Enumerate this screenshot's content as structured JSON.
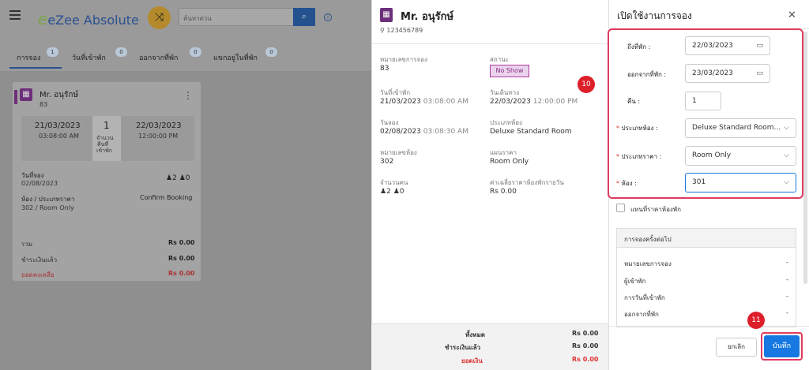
{
  "app": {
    "logo": "eZee Absolute",
    "search_placeholder": "ค้นหาด่วน"
  },
  "tabs": [
    {
      "label": "การจอง",
      "count": "1"
    },
    {
      "label": "วันที่เข้าพัก",
      "count": "0"
    },
    {
      "label": "ออกจากที่พัก",
      "count": "0"
    },
    {
      "label": "แขกอยู่ในที่พัก",
      "count": "0"
    }
  ],
  "card": {
    "guest": "Mr. อนุรักษ์",
    "id": "83",
    "checkin_date": "21/03/2023",
    "checkin_time": "03:08:00 AM",
    "nights": "1",
    "nights_label_1": "จำนวน",
    "nights_label_2": "คืนที่",
    "nights_label_3": "เข้าพัก",
    "checkout_date": "22/03/2023",
    "checkout_time": "12:00:00 PM",
    "booking_date_label": "วันที่จอง",
    "booking_date": "02/08/2023",
    "adults": "2",
    "children": "0",
    "room_rate_label": "ห้อง / ประเภทราคา",
    "room_rate": "302 / Room Only",
    "status": "Confirm Booking",
    "total_label": "รวม",
    "total": "Rs 0.00",
    "paid_label": "ชำระเงินแล้ว",
    "paid": "Rs 0.00",
    "balance_label": "ยอดคงเหลือ",
    "balance": "Rs 0.00"
  },
  "detail": {
    "guest": "Mr. อนุรักษ์",
    "phone": "123456789",
    "res_no_label": "หมายเลขการจอง",
    "res_no": "83",
    "status_label": "สถานะ",
    "status": "No Show",
    "checkin_label": "วันที่เข้าพัก",
    "checkin_date": "21/03/2023",
    "checkin_time": "03:08:00 AM",
    "depart_label": "วันเดินทาง",
    "depart_date": "22/03/2023",
    "depart_time": "12:00:00 PM",
    "booked_label": "วันจอง",
    "booked_date": "02/08/2023",
    "booked_time": "03:08:30 AM",
    "room_type_label": "ประเภทห้อง",
    "room_type": "Deluxe Standard Room",
    "room_no_label": "หมายเลขห้อง",
    "room_no": "302",
    "rate_plan_label": "แผนราคา",
    "rate_plan": "Room Only",
    "pax_label": "จำนวนคน",
    "adults": "2",
    "children": "0",
    "avg_label": "ค่าเฉลี่ยราคาห้องพักรายวัน",
    "avg": "Rs 0.00",
    "footer_total_label": "ทั้งหมด",
    "footer_total": "Rs 0.00",
    "footer_paid_label": "ชำระเงินแล้ว",
    "footer_paid": "Rs 0.00",
    "footer_balance_label": "ยอดเงิน",
    "footer_balance": "Rs 0.00"
  },
  "steps": {
    "a": "10",
    "b": "11"
  },
  "panel": {
    "title": "เปิดใช้งานการจอง",
    "arrival_label": "ถึงที่พัก :",
    "arrival": "22/03/2023",
    "departure_label": "ออกจากที่พัก :",
    "departure": "23/03/2023",
    "nights_label": "คืน :",
    "nights": "1",
    "room_type_label": "ประเภทห้อง :",
    "room_type": "Deluxe Standard Room...",
    "rate_type_label": "ประเภทราคา :",
    "rate_type": "Room Only",
    "room_label": "ห้อง :",
    "room": "301",
    "override_label": "แทนที่ราคาห้องพัก",
    "next_title": "การจองครั้งต่อไป",
    "next_items": [
      {
        "label": "หมายเลขการจอง",
        "value": "-"
      },
      {
        "label": "ผู้เข้าพัก",
        "value": "-"
      },
      {
        "label": "การวันที่เข้าพัก",
        "value": "-"
      },
      {
        "label": "ออกจากที่พัก",
        "value": "-"
      }
    ],
    "cancel": "ยกเลิก",
    "save": "บันทึก"
  },
  "colors": {
    "brand": "#2a5190",
    "accent": "#1678e0",
    "highlight": "#e03b5f",
    "purple": "#8b2f7c"
  }
}
